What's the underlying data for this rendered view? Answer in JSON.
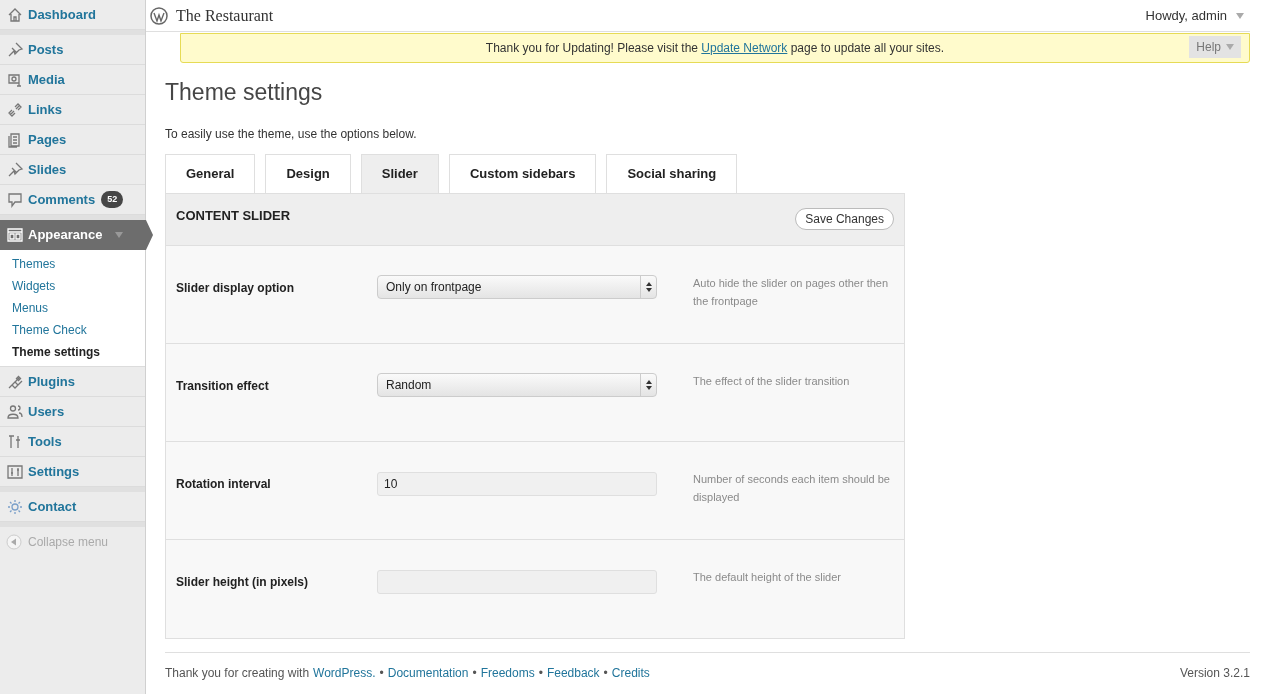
{
  "sidebar": {
    "groups": [
      [
        {
          "label": "Dashboard",
          "selected": false
        }
      ],
      [
        {
          "label": "Posts",
          "selected": false
        },
        {
          "label": "Media",
          "selected": false
        },
        {
          "label": "Links",
          "selected": false
        },
        {
          "label": "Pages",
          "selected": false
        },
        {
          "label": "Slides",
          "selected": false
        },
        {
          "label": "Comments",
          "selected": false,
          "badge": "52"
        }
      ],
      [
        {
          "label": "Appearance",
          "selected": true,
          "expanded": true,
          "children": [
            {
              "label": "Themes",
              "selected": false
            },
            {
              "label": "Widgets",
              "selected": false
            },
            {
              "label": "Menus",
              "selected": false
            },
            {
              "label": "Theme Check",
              "selected": false
            },
            {
              "label": "Theme settings",
              "selected": true
            }
          ]
        },
        {
          "label": "Plugins",
          "selected": false
        },
        {
          "label": "Users",
          "selected": false
        },
        {
          "label": "Tools",
          "selected": false
        },
        {
          "label": "Settings",
          "selected": false
        }
      ],
      [
        {
          "label": "Contact",
          "selected": false
        }
      ]
    ],
    "collapse": "Collapse menu"
  },
  "header": {
    "site_title": "The Restaurant",
    "greeting": "Howdy, admin",
    "help": "Help"
  },
  "notice": {
    "before": "Thank you for Updating! Please visit the",
    "link": "Update Network",
    "after": "page to update all your sites."
  },
  "page": {
    "title": "Theme settings",
    "intro": "To easily use the theme, use the options below."
  },
  "tabs": [
    {
      "label": "General",
      "selected": false
    },
    {
      "label": "Design",
      "selected": false
    },
    {
      "label": "Slider",
      "selected": true
    },
    {
      "label": "Custom sidebars",
      "selected": false
    },
    {
      "label": "Social sharing",
      "selected": false
    }
  ],
  "panel": {
    "title": "CONTENT SLIDER",
    "save": "Save Changes",
    "fields": [
      {
        "kind": "select",
        "label": "Slider display option",
        "value": "Only on frontpage",
        "help": "Auto hide the slider on pages other then the frontpage"
      },
      {
        "kind": "select",
        "label": "Transition effect",
        "value": "Random",
        "help": "The effect of the slider transition"
      },
      {
        "kind": "text",
        "label": "Rotation interval",
        "value": "10",
        "help": "Number of seconds each item should be displayed"
      },
      {
        "kind": "text",
        "label": "Slider height (in pixels)",
        "help": "The default height of the slider"
      }
    ]
  },
  "footer": {
    "prefix": "Thank you for creating with",
    "links": [
      "WordPress.",
      "Documentation",
      "Freedoms",
      "Feedback",
      "Credits"
    ],
    "separators": [
      "•",
      "•",
      "•",
      "•"
    ],
    "version": "Version 3.2.1"
  }
}
